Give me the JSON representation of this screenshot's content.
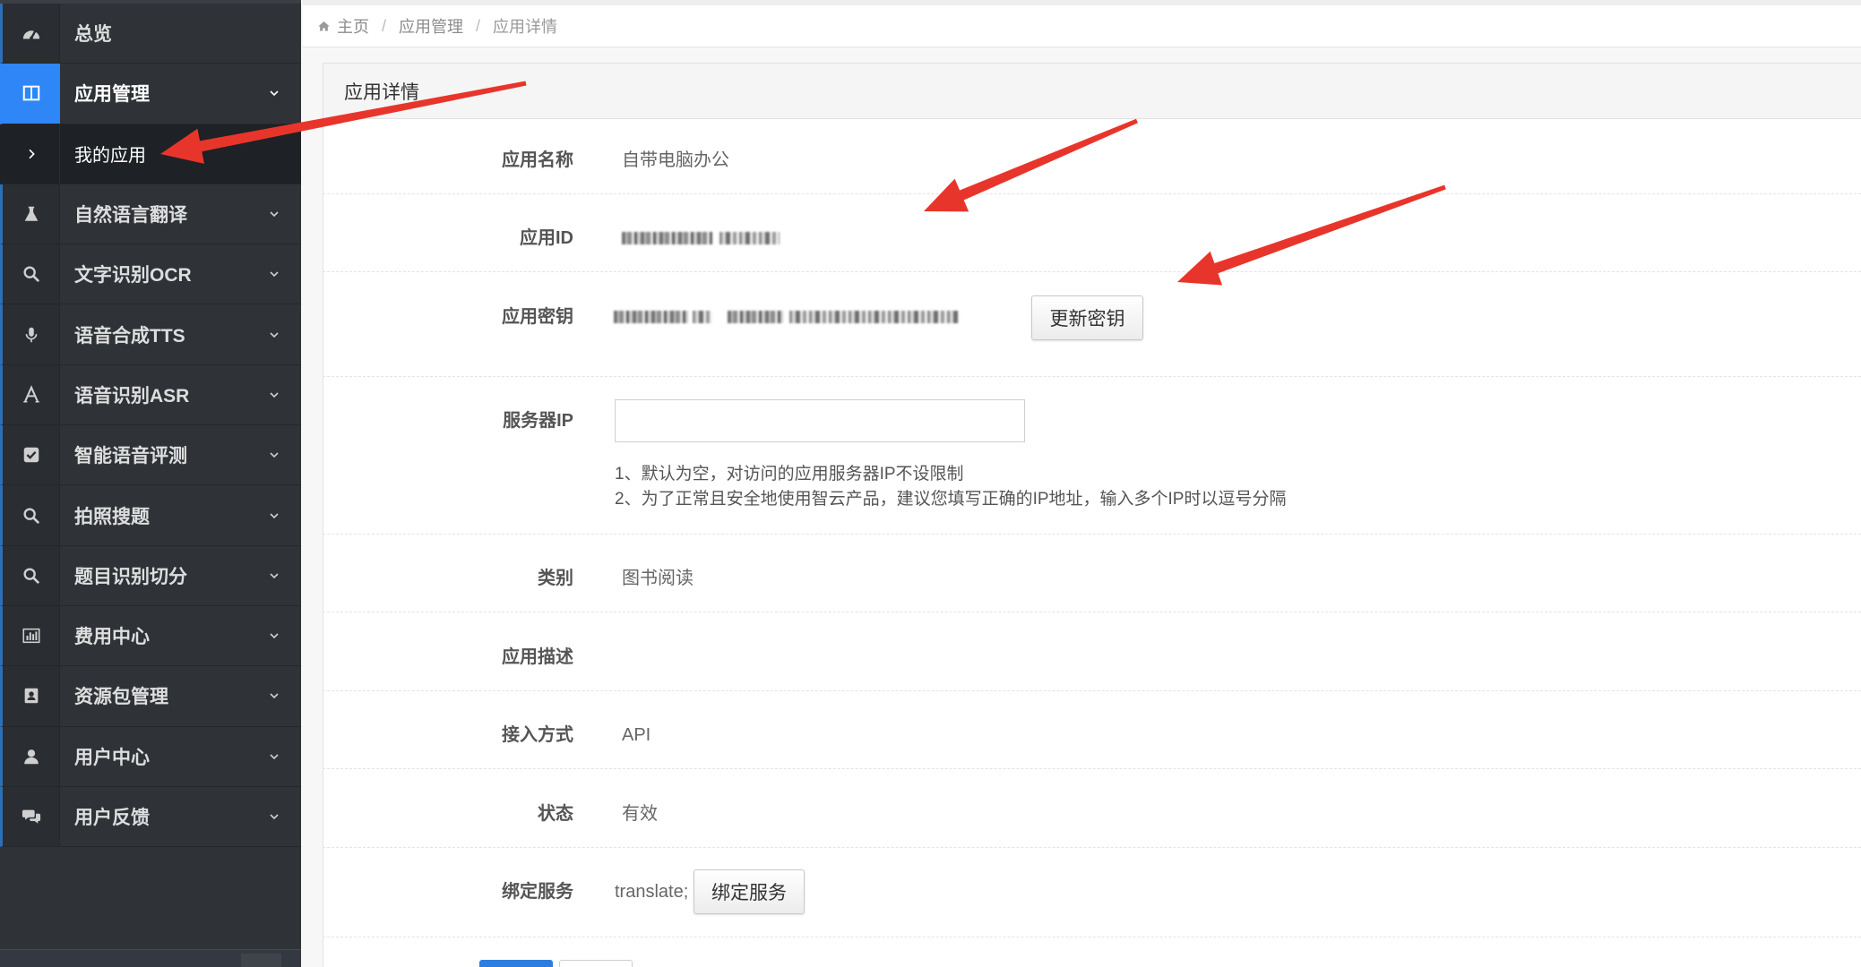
{
  "sidebar": {
    "items": [
      {
        "label": "总览",
        "icon": "dashboard-icon"
      },
      {
        "label": "应用管理",
        "icon": "columns-icon",
        "active": true,
        "expanded": true,
        "children": [
          {
            "label": "我的应用",
            "icon": "chevron-right-icon",
            "active": true
          }
        ]
      },
      {
        "label": "自然语言翻译",
        "icon": "flask-icon"
      },
      {
        "label": "文字识别OCR",
        "icon": "search-icon"
      },
      {
        "label": "语音合成TTS",
        "icon": "microphone-icon"
      },
      {
        "label": "语音识别ASR",
        "icon": "font-icon"
      },
      {
        "label": "智能语音评测",
        "icon": "check-square-icon"
      },
      {
        "label": "拍照搜题",
        "icon": "search-icon"
      },
      {
        "label": "题目识别切分",
        "icon": "search-icon"
      },
      {
        "label": "费用中心",
        "icon": "bar-chart-icon"
      },
      {
        "label": "资源包管理",
        "icon": "address-book-icon"
      },
      {
        "label": "用户中心",
        "icon": "user-icon"
      },
      {
        "label": "用户反馈",
        "icon": "comments-icon"
      }
    ]
  },
  "breadcrumb": {
    "home_icon": "home-icon",
    "home": "主页",
    "separator": "/",
    "items": [
      "应用管理",
      "应用详情"
    ]
  },
  "panel": {
    "title": "应用详情"
  },
  "form": {
    "app_name": {
      "label": "应用名称",
      "value": "自带电脑办公"
    },
    "app_id": {
      "label": "应用ID",
      "masked": true
    },
    "app_secret": {
      "label": "应用密钥",
      "masked": true,
      "button": "更新密钥"
    },
    "server_ip": {
      "label": "服务器IP",
      "value": "",
      "help": [
        "1、默认为空，对访问的应用服务器IP不设限制",
        "2、为了正常且安全地使用智云产品，建议您填写正确的IP地址，输入多个IP时以逗号分隔"
      ]
    },
    "category": {
      "label": "类别",
      "value": "图书阅读"
    },
    "description": {
      "label": "应用描述",
      "value": ""
    },
    "access_method": {
      "label": "接入方式",
      "value": "API"
    },
    "status": {
      "label": "状态",
      "value": "有效"
    },
    "bound_services": {
      "label": "绑定服务",
      "value": "translate;",
      "button": "绑定服务"
    }
  },
  "colors": {
    "accent": "#2e86f7",
    "sidebar_bg": "#2f3338",
    "submenu_bg": "#1e2125",
    "annotation_red": "#e8352b"
  }
}
